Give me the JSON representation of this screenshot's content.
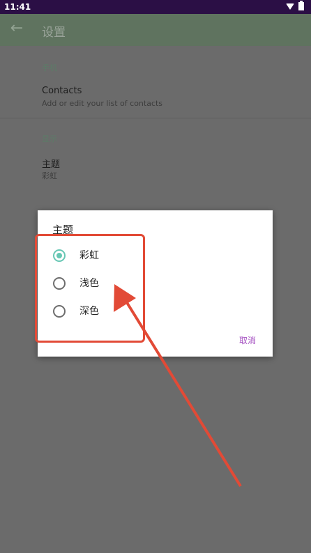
{
  "status_bar": {
    "time": "11:41"
  },
  "app_bar": {
    "title": "设置"
  },
  "sections": [
    {
      "header": "手机",
      "pref_title": "Contacts",
      "pref_summary": "Add or edit your list of contacts"
    },
    {
      "header": "显示",
      "pref_title": "主题",
      "pref_summary": "彩虹"
    }
  ],
  "dialog": {
    "title": "主题",
    "options": [
      {
        "label": "彩虹",
        "checked": true
      },
      {
        "label": "浅色",
        "checked": false
      },
      {
        "label": "深色",
        "checked": false
      }
    ],
    "cancel_label": "取消"
  },
  "colors": {
    "status_bar": "#2b0f45",
    "app_bar": "#5f735f",
    "accent_radio": "#67c7b4",
    "dialog_button": "#a44fc1",
    "annotation": "#e24a36"
  }
}
